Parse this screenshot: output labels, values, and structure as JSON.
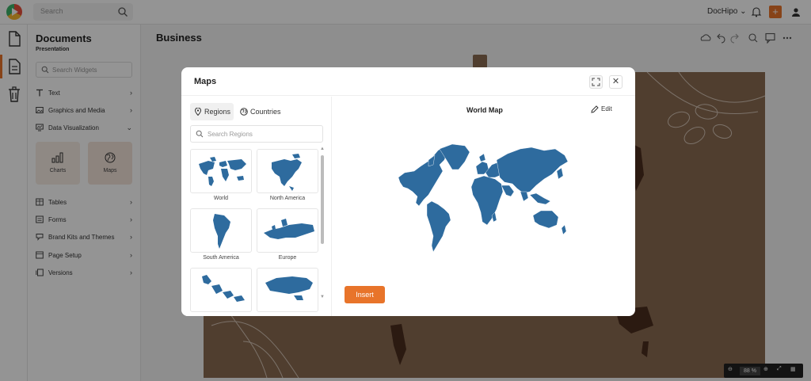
{
  "topbar": {
    "search_placeholder": "Search",
    "doc_menu_label": "DocHipo",
    "plus_label": "+"
  },
  "panel": {
    "title": "Documents",
    "subtitle": "Presentation",
    "search_placeholder": "Search Widgets",
    "menu_items": [
      {
        "label": "Text",
        "icon": "text-icon",
        "chevron": "›"
      },
      {
        "label": "Graphics and Media",
        "icon": "image-icon",
        "chevron": "›"
      },
      {
        "label": "Data Visualization",
        "icon": "chart-icon",
        "chevron": "⌄"
      },
      {
        "label": "Tables",
        "icon": "table-icon",
        "chevron": "›"
      },
      {
        "label": "Forms",
        "icon": "form-icon",
        "chevron": "›"
      },
      {
        "label": "Brand Kits and Themes",
        "icon": "brand-icon",
        "chevron": "›"
      },
      {
        "label": "Page Setup",
        "icon": "page-icon",
        "chevron": "›"
      },
      {
        "label": "Versions",
        "icon": "versions-icon",
        "chevron": "›"
      }
    ],
    "widget_tiles": [
      {
        "label": "Charts",
        "icon": "bar-chart-icon"
      },
      {
        "label": "Maps",
        "icon": "globe-icon"
      }
    ]
  },
  "main": {
    "title": "Business",
    "zoom_value": "88",
    "zoom_unit": "%"
  },
  "modal": {
    "title": "Maps",
    "tabs": [
      {
        "label": "Regions",
        "icon": "pin-icon",
        "active": true
      },
      {
        "label": "Countries",
        "icon": "globe-icon",
        "active": false
      }
    ],
    "search_placeholder": "Search Regions",
    "regions": [
      {
        "label": "World"
      },
      {
        "label": "North America"
      },
      {
        "label": "South America"
      },
      {
        "label": "Europe"
      },
      {
        "label": ""
      },
      {
        "label": ""
      }
    ],
    "preview_title": "World Map",
    "edit_label": "Edit",
    "insert_label": "Insert",
    "map_color": "#2e6b9e"
  },
  "colors": {
    "accent": "#e8742a",
    "map_blue": "#2e6b9e",
    "canvas_brown": "#8a6b52"
  }
}
